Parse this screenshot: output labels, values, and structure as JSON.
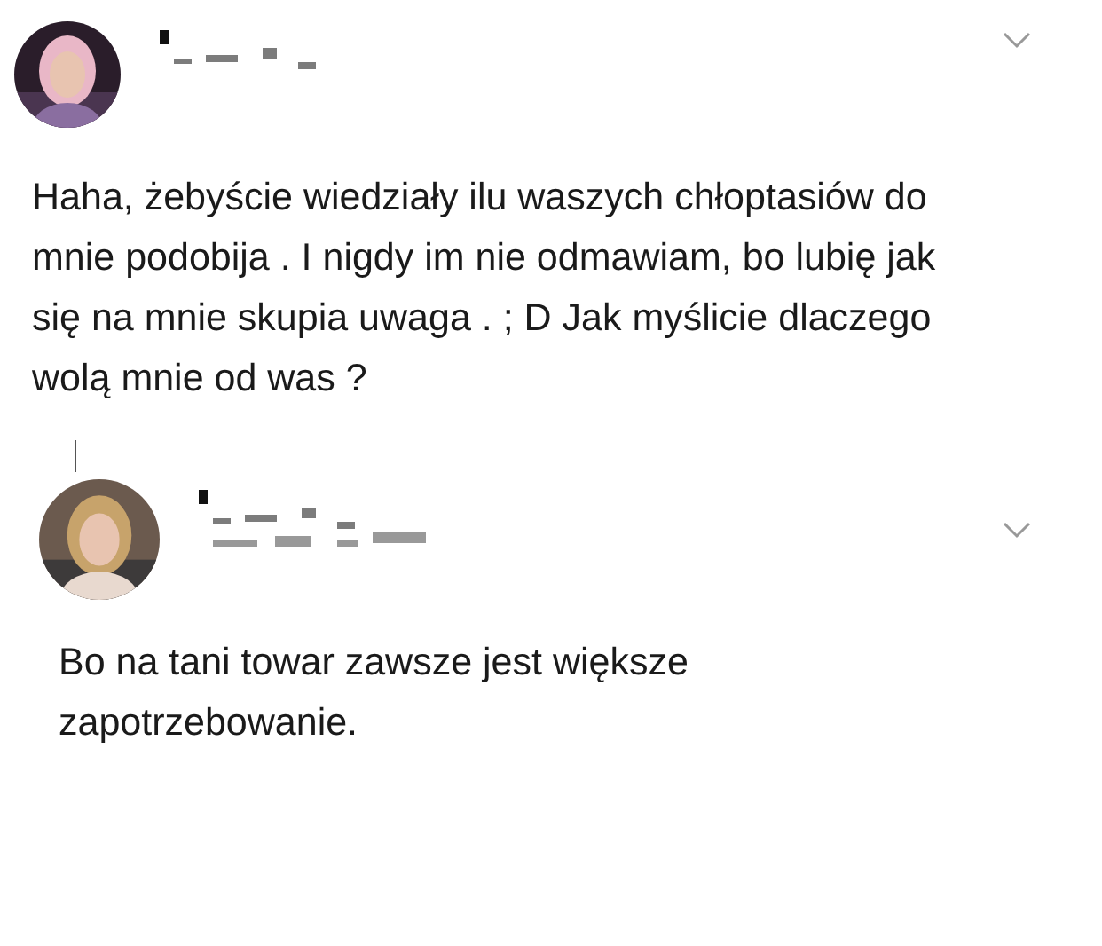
{
  "posts": [
    {
      "text": "Haha, żebyście wiedziały ilu waszych chłoptasiów do mnie podobija . I nigdy im nie odmawiam, bo lubię jak się na mnie skupia uwaga . ; D Jak myślicie dlaczego wolą mnie od was ?",
      "reply": false
    },
    {
      "text": "Bo na tani towar zawsze jest większe zapotrzebowanie.",
      "reply": true
    }
  ]
}
